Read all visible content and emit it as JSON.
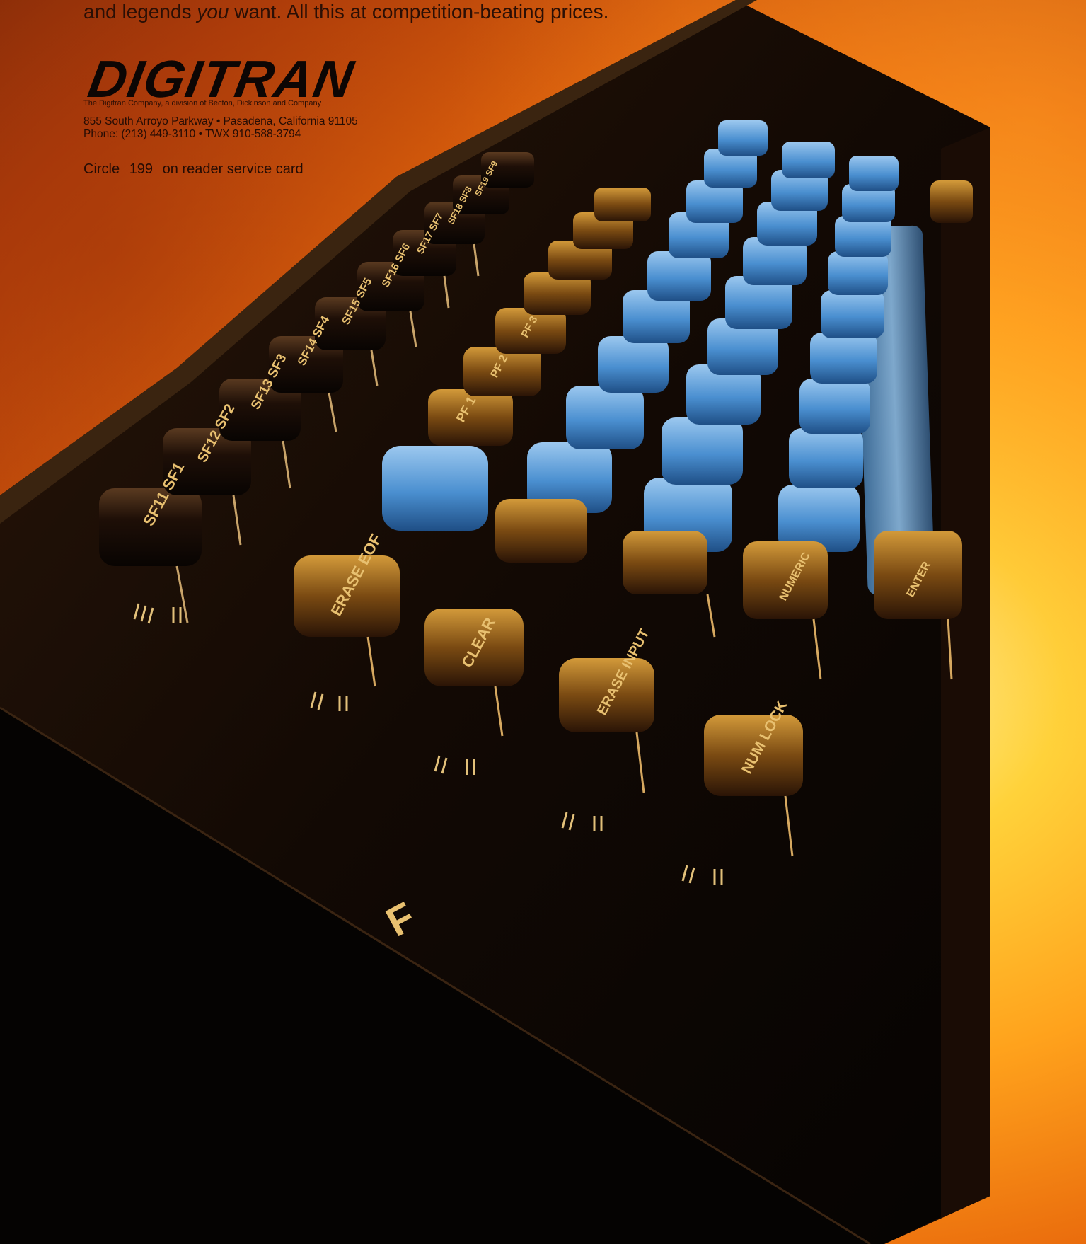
{
  "ad": {
    "tagline_prefix": "and legends ",
    "tagline_em": "you",
    "tagline_suffix": " want. All this at competition-beating prices.",
    "brand": "DIGITRAN",
    "division": "The Digitran Company, a division of Becton, Dickinson and Company",
    "address": "855 South Arroyo Parkway • Pasadena, California 91105",
    "phone": "Phone: (213) 449-3110 • TWX 910-588-3794",
    "circle_prefix": "Circle",
    "circle_number": "199",
    "circle_suffix": "on reader service card"
  },
  "keyboard": {
    "function_keys": [
      "SF11 SF1",
      "SF12 SF2",
      "SF13 SF3",
      "SF14 SF4",
      "SF15 SF5",
      "SF16 SF6",
      "SF17 SF7",
      "SF18 SF8",
      "SF19 SF9"
    ],
    "pf_keys": [
      "PF 1",
      "PF 2",
      "PF 3"
    ],
    "edit_keys": [
      "ERASE EOF",
      "CLEAR",
      "ERASE INPUT",
      "NUM LOCK",
      "NUMERIC",
      "ENTER"
    ],
    "case_letter": "F",
    "colors": {
      "blue_key": "#4a8fd0",
      "dark_key": "#1a0d06",
      "amber_key": "#b07520",
      "chassis": "#0c0704"
    }
  }
}
